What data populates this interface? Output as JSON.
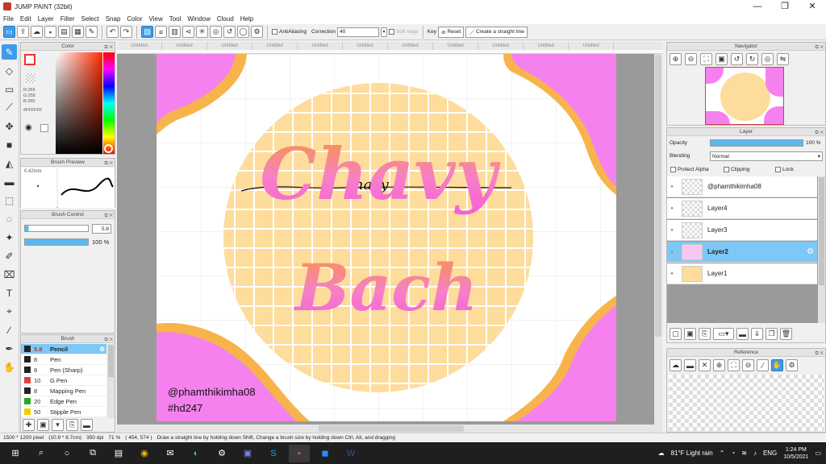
{
  "app": {
    "title": "JUMP PAINT (32bit)",
    "window_controls": [
      "—",
      "❐",
      "✕"
    ]
  },
  "menu": [
    "File",
    "Edit",
    "Layer",
    "Filter",
    "Select",
    "Snap",
    "Color",
    "View",
    "Tool",
    "Window",
    "Cloud",
    "Help"
  ],
  "toolbar": {
    "antialiasing_label": "AntiAliasing",
    "correction_label": "Correction",
    "correction_value": "40",
    "soft_edge_label": "Soft edge",
    "key_label": "Key",
    "reset_label": "Reset",
    "straight_line_label": "Create a straight line"
  },
  "color_panel": {
    "title": "Color",
    "r": "R:255",
    "g": "G:255",
    "b": "B:255",
    "hex": "#FFFFFF"
  },
  "brush_preview": {
    "title": "Brush Preview",
    "size": "0.42mm"
  },
  "brush_control": {
    "title": "Brush Control",
    "size_value": "5.8",
    "opacity_value": "100 %"
  },
  "brush_list": {
    "title": "Brush",
    "items": [
      {
        "size": "5.8",
        "name": "Pencil",
        "color": "#222222"
      },
      {
        "size": "8",
        "name": "Pen",
        "color": "#222222"
      },
      {
        "size": "8",
        "name": "Pen (Sharp)",
        "color": "#222222"
      },
      {
        "size": "10",
        "name": "G Pen",
        "color": "#e04040"
      },
      {
        "size": "8",
        "name": "Mapping Pen",
        "color": "#222222"
      },
      {
        "size": "20",
        "name": "Edge Pen",
        "color": "#22aa22"
      },
      {
        "size": "50",
        "name": "Stipple Pen",
        "color": "#f0d000"
      }
    ]
  },
  "tabs": [
    "Untitled",
    "Untitled",
    "Untitled",
    "Untitled",
    "Untitled",
    "Untitled",
    "Untitled",
    "Untitled",
    "Untitled",
    "Untitled",
    "Untitled"
  ],
  "artwork": {
    "word1": "Chavy",
    "word2": "Bach",
    "script_text": "chavy",
    "credit1": "@phamthikimha08",
    "credit2": "#hd247",
    "colors": {
      "pink": "#f581ee",
      "orange": "#f7b44c",
      "peach": "#fddc9c"
    }
  },
  "navigator": {
    "title": "Navigator"
  },
  "layer_panel": {
    "title": "Layer",
    "opacity_label": "Opacity",
    "opacity_value": "100 %",
    "blending_label": "Blending",
    "blending_value": "Normal",
    "protect_alpha": "Protect Alpha",
    "clipping": "Clipping",
    "lock": "Lock",
    "layers": [
      {
        "name": "@phamthikimha08",
        "selected": false
      },
      {
        "name": "Layer4",
        "selected": false
      },
      {
        "name": "Layer3",
        "selected": false
      },
      {
        "name": "Layer2",
        "selected": true
      },
      {
        "name": "Layer1",
        "selected": false
      }
    ]
  },
  "reference": {
    "title": "Reference"
  },
  "status": {
    "size": "1500 * 1200 pixel",
    "cm": "(10.9 * 8.7cm)",
    "dpi": "350 dpi",
    "zoom": "71 %",
    "coords": "( 454, 574 )",
    "hint": "Draw a straight line by holding down Shift, Change a brush size by holding down Ctrl, Alt, and dragging"
  },
  "taskbar": {
    "weather": "81°F  Light rain",
    "lang": "ENG",
    "time": "1:24 PM",
    "date": "10/5/2021"
  }
}
